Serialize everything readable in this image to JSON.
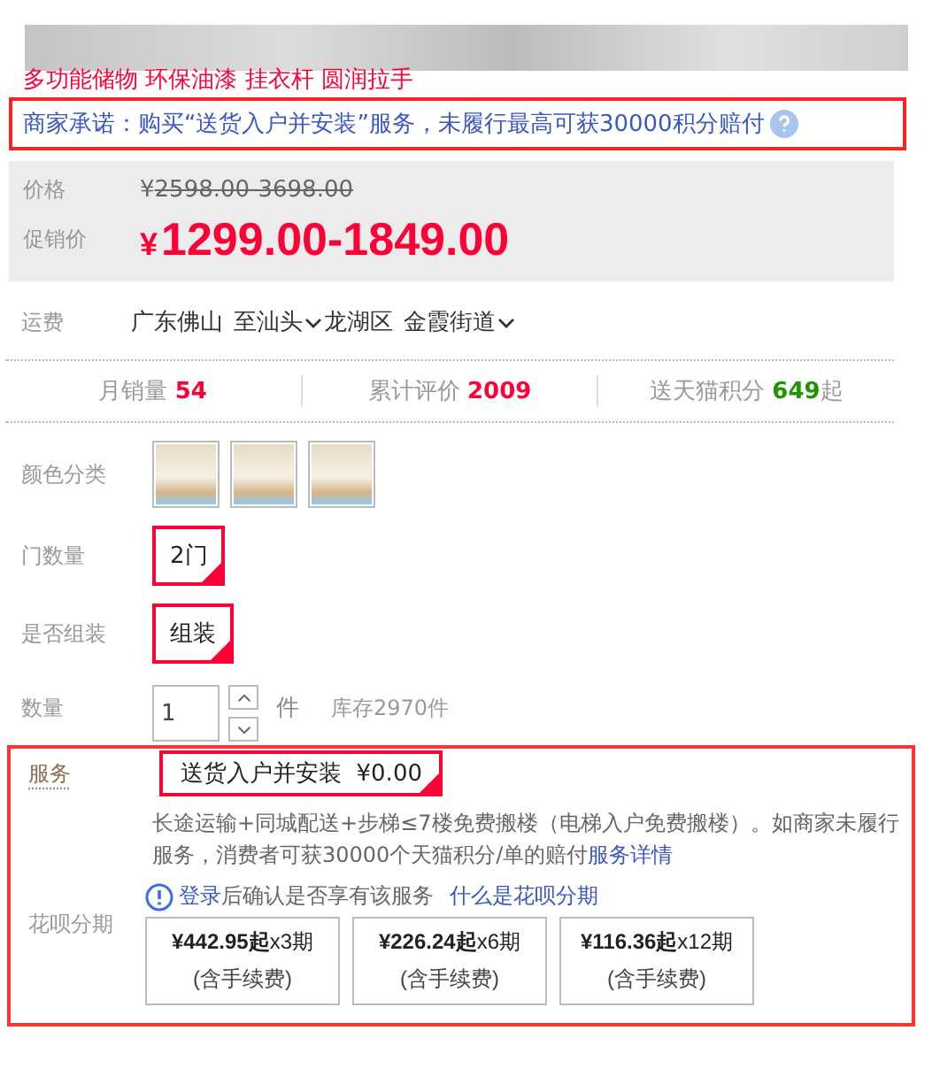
{
  "subtitle": "多功能储物 环保油漆 挂衣杆 圆润拉手",
  "promise": {
    "text": "商家承诺：购买“送货入户并安装”服务，未履行最高可获30000积分赔付"
  },
  "price": {
    "label": "价格",
    "currency": "¥",
    "original": "2598.00-3698.00"
  },
  "promo": {
    "label": "促销价",
    "currency": "¥",
    "value": "1299.00-1849.00"
  },
  "shipping": {
    "label": "运费",
    "from": "广东佛山",
    "to": "至",
    "city": "汕头",
    "district": "龙湖区",
    "street": "金霞街道"
  },
  "stats": [
    {
      "label": "月销量",
      "value": "54",
      "color": "#ff0036"
    },
    {
      "label": "累计评价",
      "value": "2009",
      "color": "#ff0036"
    },
    {
      "label": "送天猫积分",
      "value": "649",
      "suffix": "起",
      "color": "#1f9500"
    }
  ],
  "color_option": {
    "label": "颜色分类",
    "items": [
      {
        "selected": false
      },
      {
        "selected": false
      },
      {
        "selected": false
      }
    ]
  },
  "options": [
    {
      "label": "门数量",
      "items": [
        {
          "text": "2门",
          "selected": true
        }
      ]
    },
    {
      "label": "是否组装",
      "items": [
        {
          "text": "组装",
          "selected": true
        }
      ]
    }
  ],
  "quantity": {
    "label": "数量",
    "value": "1",
    "unit": "件",
    "stock": "库存2970件"
  },
  "service": {
    "label": "服务",
    "items": [
      {
        "name": "送货入户并安装",
        "price": "¥0.00",
        "selected": true
      }
    ],
    "description": "长途运输+同城配送+步梯≤7楼免费搬楼（电梯入户免费搬楼）。如商家未履行服务，消费者可获30000个天猫积分/单的赔付",
    "detail_link": "服务详情"
  },
  "installment": {
    "label": "花呗分期",
    "login_link": "登录",
    "notice": "后确认是否享有该服务",
    "help_link": "什么是花呗分期",
    "plans": [
      {
        "amount": "¥442.95起",
        "periods": "x3期",
        "fee": "(含手续费)",
        "selected": false
      },
      {
        "amount": "¥226.24起",
        "periods": "x6期",
        "fee": "(含手续费)",
        "selected": false
      },
      {
        "amount": "¥116.36起",
        "periods": "x12期",
        "fee": "(含手续费)",
        "selected": false
      }
    ]
  }
}
